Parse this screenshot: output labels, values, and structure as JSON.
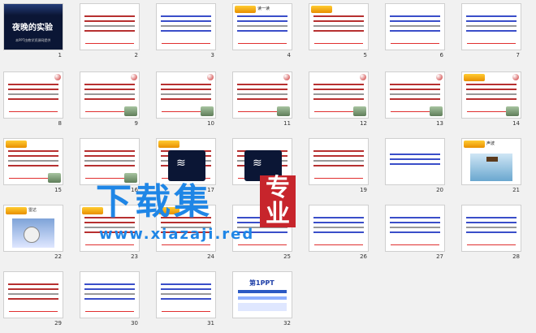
{
  "slides": [
    {
      "n": "1",
      "title": "夜晚的实验",
      "sub": "本PPT由教学资源网提供"
    },
    {
      "n": "2"
    },
    {
      "n": "3"
    },
    {
      "n": "4",
      "title": "读一读"
    },
    {
      "n": "5"
    },
    {
      "n": "6"
    },
    {
      "n": "7"
    },
    {
      "n": "8"
    },
    {
      "n": "9"
    },
    {
      "n": "10"
    },
    {
      "n": "11"
    },
    {
      "n": "12"
    },
    {
      "n": "13"
    },
    {
      "n": "14"
    },
    {
      "n": "15"
    },
    {
      "n": "16"
    },
    {
      "n": "17"
    },
    {
      "n": "18"
    },
    {
      "n": "19"
    },
    {
      "n": "20"
    },
    {
      "n": "21",
      "title": "声波"
    },
    {
      "n": "22",
      "title": "雷达"
    },
    {
      "n": "23"
    },
    {
      "n": "24"
    },
    {
      "n": "25"
    },
    {
      "n": "26"
    },
    {
      "n": "27"
    },
    {
      "n": "28"
    },
    {
      "n": "29"
    },
    {
      "n": "30"
    },
    {
      "n": "31"
    },
    {
      "n": "32",
      "title": "第1PPT"
    }
  ],
  "watermark": {
    "main": "下载集",
    "tag": "专业",
    "url": "www.xiazaji.red"
  },
  "colors": {
    "accent": "#e03030",
    "watermark_blue": "#1f86e6",
    "watermark_red": "#c7252c"
  }
}
